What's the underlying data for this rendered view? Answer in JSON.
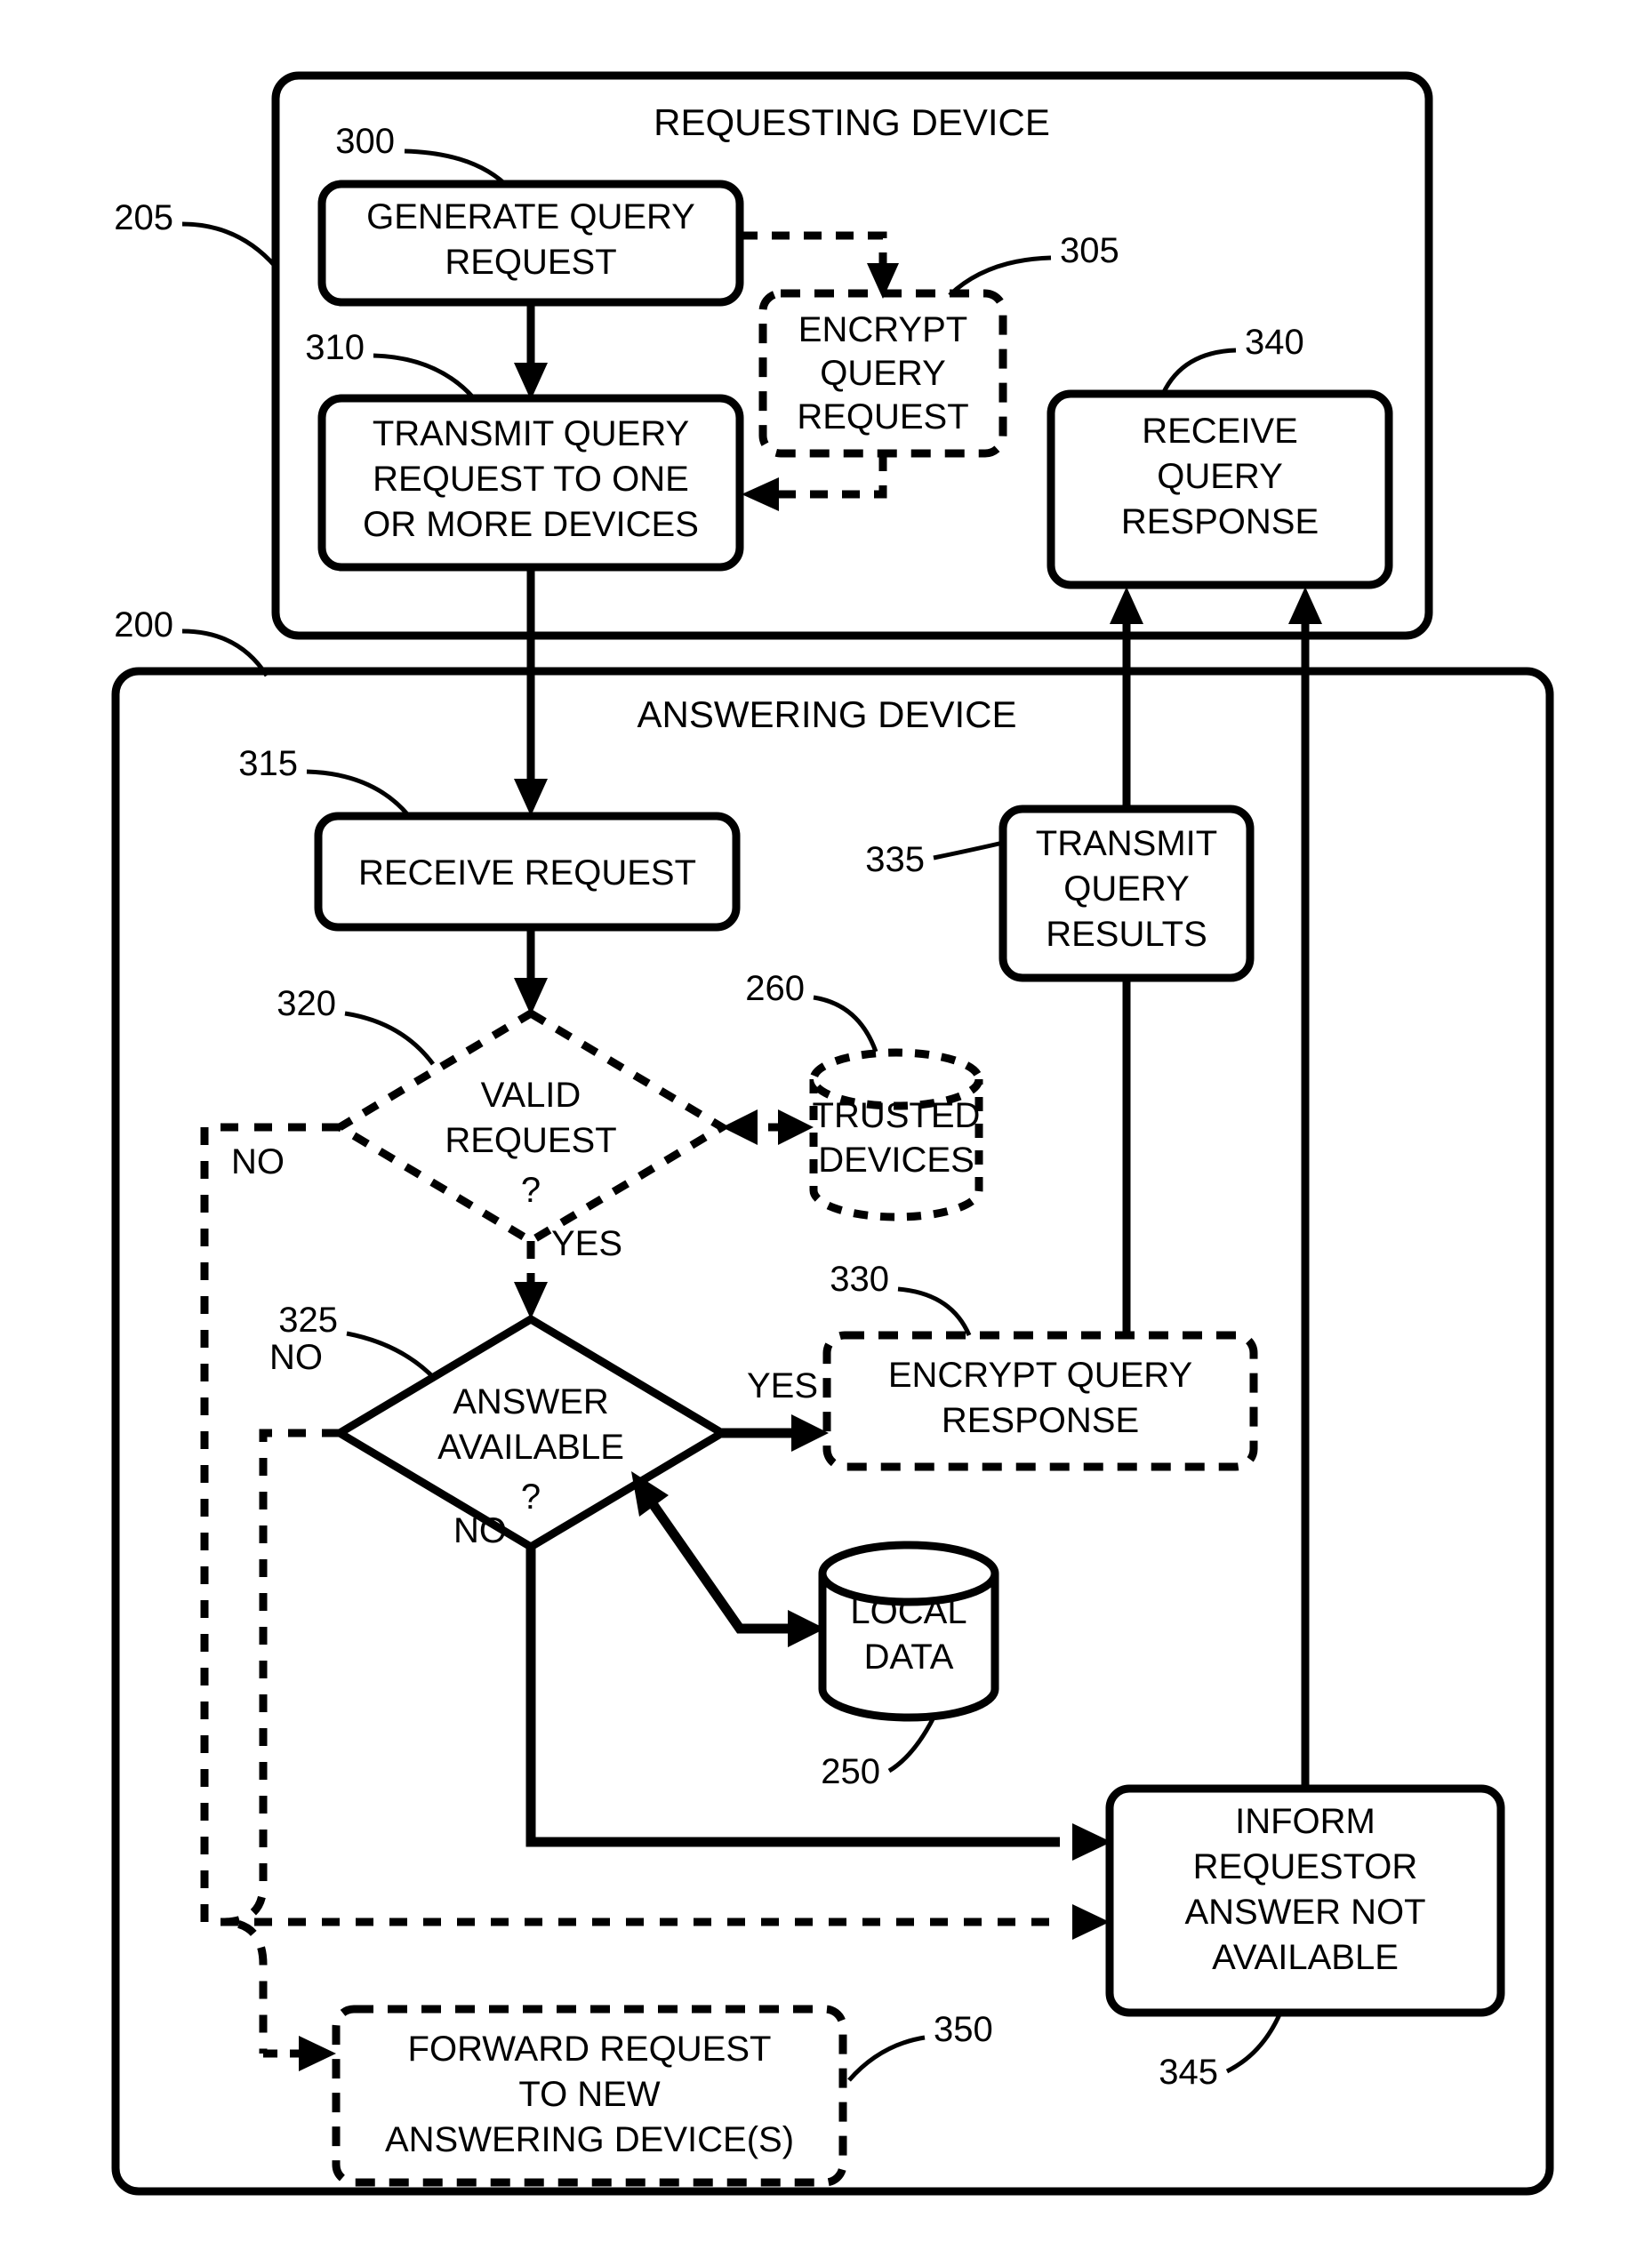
{
  "figure": {
    "type": "patent-flowchart",
    "title_visible": false
  },
  "containers": [
    {
      "id": "requesting-device",
      "label": "REQUESTING DEVICE",
      "ref": "205",
      "style": "solid"
    },
    {
      "id": "answering-device",
      "label": "ANSWERING DEVICE",
      "ref": "200",
      "style": "solid"
    }
  ],
  "nodes": {
    "generate_query_request": {
      "ref": "300",
      "lines": [
        "GENERATE QUERY",
        "REQUEST"
      ],
      "shape": "rounded-rect",
      "border": "solid"
    },
    "encrypt_query_request": {
      "ref": "305",
      "lines": [
        "ENCRYPT",
        "QUERY",
        "REQUEST"
      ],
      "shape": "rounded-rect",
      "border": "dashed"
    },
    "transmit_query_request": {
      "ref": "310",
      "lines": [
        "TRANSMIT QUERY",
        "REQUEST TO ONE",
        "OR MORE DEVICES"
      ],
      "shape": "rounded-rect",
      "border": "solid"
    },
    "receive_query_response": {
      "ref": "340",
      "lines": [
        "RECEIVE",
        "QUERY",
        "RESPONSE"
      ],
      "shape": "rounded-rect",
      "border": "solid"
    },
    "receive_request": {
      "ref": "315",
      "lines": [
        "RECEIVE REQUEST"
      ],
      "shape": "rounded-rect",
      "border": "solid"
    },
    "transmit_query_results": {
      "ref": "335",
      "lines": [
        "TRANSMIT",
        "QUERY",
        "RESULTS"
      ],
      "shape": "rounded-rect",
      "border": "solid"
    },
    "valid_request": {
      "ref": "320",
      "lines": [
        "VALID",
        "REQUEST",
        "?"
      ],
      "shape": "diamond",
      "border": "dashed"
    },
    "trusted_devices": {
      "ref": "260",
      "lines": [
        "TRUSTED",
        "DEVICES"
      ],
      "shape": "cylinder",
      "border": "dashed"
    },
    "answer_available": {
      "ref": "325",
      "lines": [
        "ANSWER",
        "AVAILABLE",
        "?"
      ],
      "shape": "diamond",
      "border": "solid"
    },
    "encrypt_query_response": {
      "ref": "330",
      "lines": [
        "ENCRYPT QUERY",
        "RESPONSE"
      ],
      "shape": "rounded-rect",
      "border": "dashed"
    },
    "local_data": {
      "ref": "250",
      "lines": [
        "LOCAL",
        "DATA"
      ],
      "shape": "cylinder",
      "border": "solid"
    },
    "inform_requestor": {
      "ref": "345",
      "lines": [
        "INFORM",
        "REQUESTOR",
        "ANSWER NOT",
        "AVAILABLE"
      ],
      "shape": "rounded-rect",
      "border": "solid"
    },
    "forward_request": {
      "ref": "350",
      "lines": [
        "FORWARD REQUEST",
        "TO NEW",
        "ANSWERING DEVICE(S)"
      ],
      "shape": "rounded-rect",
      "border": "dashed"
    }
  },
  "edge_labels": {
    "valid_no": "NO",
    "valid_yes": "YES",
    "answer_no_left": "NO",
    "answer_no_down": "NO",
    "answer_yes": "YES"
  },
  "reference_numerals": [
    "205",
    "200",
    "300",
    "305",
    "310",
    "340",
    "315",
    "335",
    "320",
    "260",
    "325",
    "330",
    "250",
    "345",
    "350"
  ]
}
